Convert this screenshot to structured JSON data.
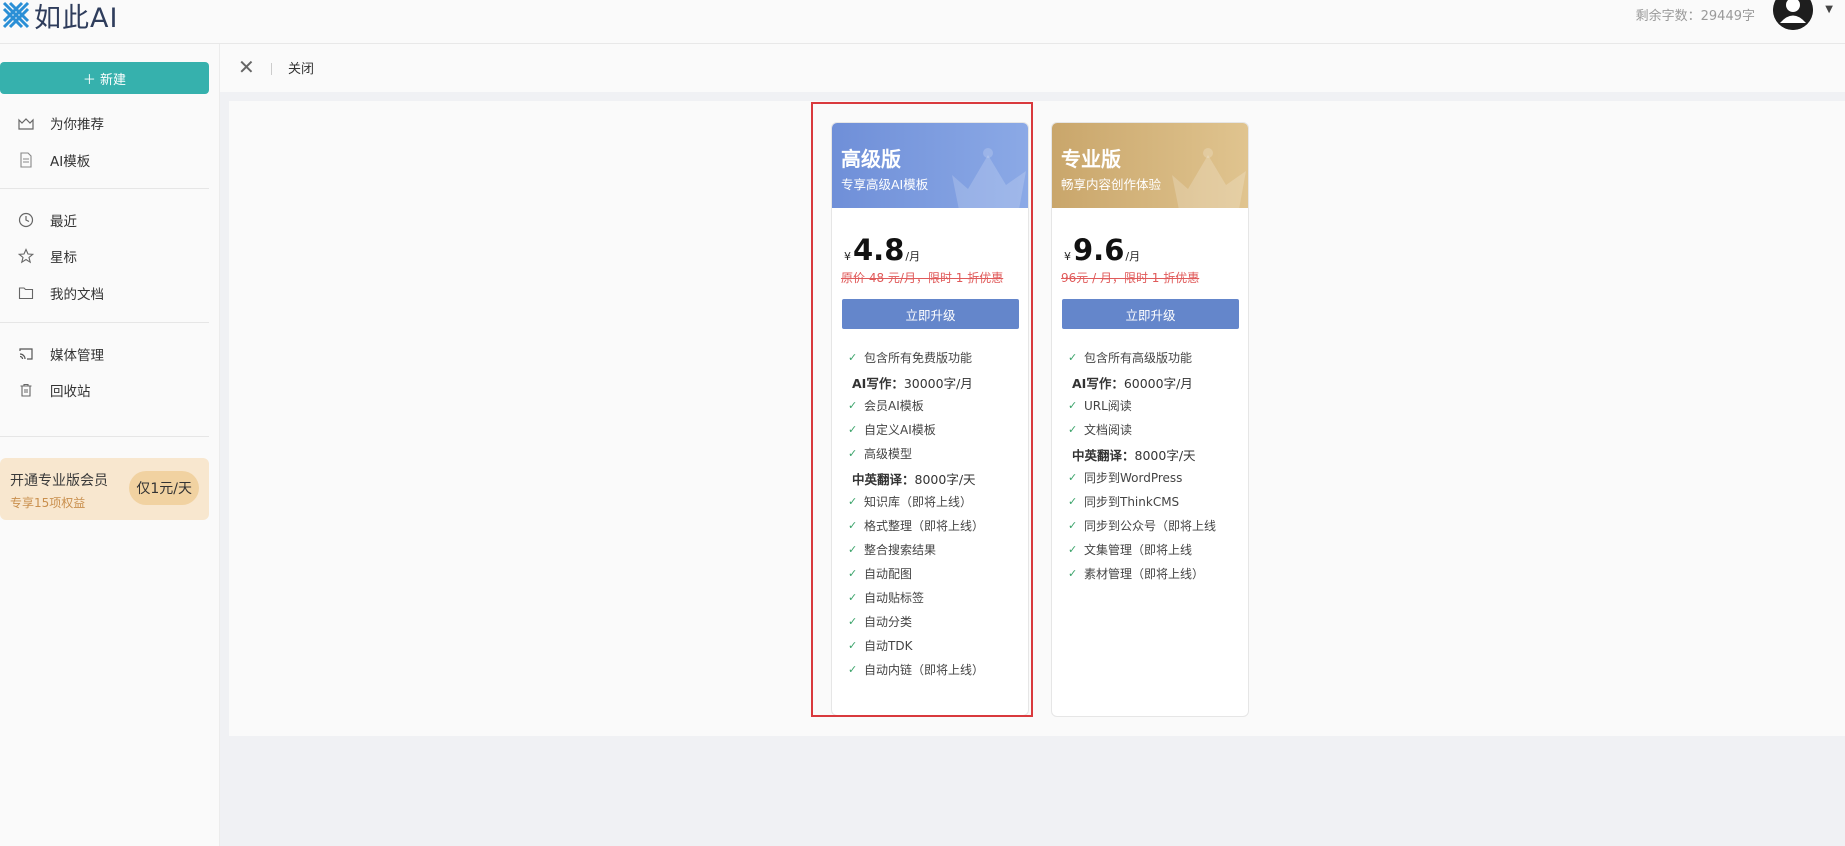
{
  "header": {
    "brand": "如此AI",
    "quota": "剩余字数：29449字"
  },
  "sidebar": {
    "new_label": "＋ 新建",
    "items": [
      {
        "label": "为你推荐",
        "icon": "inbox-icon"
      },
      {
        "label": "AI模板",
        "icon": "document-icon"
      },
      {
        "label": "最近",
        "icon": "clock-icon"
      },
      {
        "label": "星标",
        "icon": "star-icon"
      },
      {
        "label": "我的文档",
        "icon": "folder-icon"
      },
      {
        "label": "媒体管理",
        "icon": "cast-icon"
      },
      {
        "label": "回收站",
        "icon": "trash-icon"
      }
    ],
    "promo": {
      "title": "开通专业版会员",
      "subtitle": "专享15项权益",
      "pill": "仅1元/天"
    }
  },
  "subbar": {
    "close_label": "关闭"
  },
  "plans": [
    {
      "name": "高级版",
      "subtitle": "专享高级AI模板",
      "currency": "¥",
      "price": "4.8",
      "period": "/月",
      "original": "原价 48 元/月，限时 1 折优惠",
      "button": "立即升级",
      "header_color": "#6f8fd8",
      "features": [
        {
          "text": "包含所有免费版功能",
          "heading": false
        },
        {
          "bold": "AI写作：",
          "text": "30000字/月",
          "heading": true
        },
        {
          "text": "会员AI模板",
          "heading": false
        },
        {
          "text": "自定义AI模板",
          "heading": false
        },
        {
          "text": "高级模型",
          "heading": false
        },
        {
          "bold": "中英翻译：",
          "text": "8000字/天",
          "heading": true
        },
        {
          "text": "知识库（即将上线）",
          "heading": false
        },
        {
          "text": "格式整理（即将上线）",
          "heading": false
        },
        {
          "text": "整合搜索结果",
          "heading": false
        },
        {
          "text": "自动配图",
          "heading": false
        },
        {
          "text": "自动贴标签",
          "heading": false
        },
        {
          "text": "自动分类",
          "heading": false
        },
        {
          "text": "自动TDK",
          "heading": false
        },
        {
          "text": "自动内链（即将上线）",
          "heading": false
        }
      ]
    },
    {
      "name": "专业版",
      "subtitle": "畅享内容创作体验",
      "currency": "¥",
      "price": "9.6",
      "period": "/月",
      "original": "96元 / 月，限时 1 折优惠",
      "button": "立即升级",
      "header_color": "#c9a66b",
      "features": [
        {
          "text": "包含所有高级版功能",
          "heading": false
        },
        {
          "bold": "AI写作：",
          "text": "60000字/月",
          "heading": true
        },
        {
          "text": "URL阅读",
          "heading": false
        },
        {
          "text": "文档阅读",
          "heading": false
        },
        {
          "bold": "中英翻译：",
          "text": "8000字/天",
          "heading": true
        },
        {
          "text": "同步到WordPress",
          "heading": false
        },
        {
          "text": "同步到ThinkCMS",
          "heading": false
        },
        {
          "text": "同步到公众号（即将上线",
          "heading": false
        },
        {
          "text": "文集管理（即将上线",
          "heading": false
        },
        {
          "text": "素材管理（即将上线）",
          "heading": false
        }
      ]
    }
  ]
}
